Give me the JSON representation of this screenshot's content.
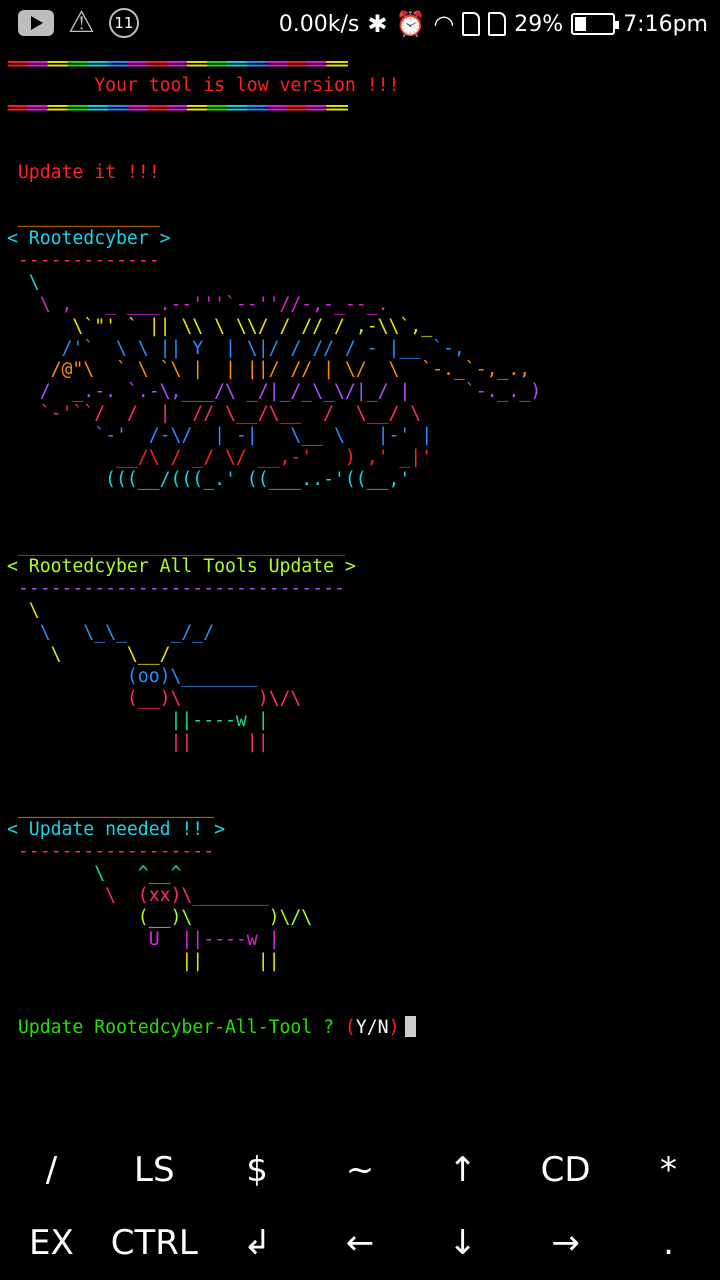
{
  "status_bar": {
    "notification_count": "11",
    "net_speed": "0.00k/s",
    "battery_percent": "29%",
    "battery_level": 0.29,
    "time": "7:16pm"
  },
  "terminal": {
    "lines": [
      {
        "text": "===================================================",
        "color": "rainbow"
      },
      {
        "text": "        Your tool is low version !!!",
        "color": "#ff2020"
      },
      {
        "text": "===================================================",
        "color": "rainbow"
      },
      {
        "text": "",
        "color": "#ffffff"
      },
      {
        "text": "",
        "color": "#ffffff"
      },
      {
        "text": " Update it !!!",
        "color": "#ff2020"
      },
      {
        "text": "",
        "color": "#ffffff"
      },
      {
        "text": " _____________",
        "color": "#ff8c00"
      },
      {
        "text": "< Rootedcyber >",
        "color": "#19d3e6"
      },
      {
        "text": " -------------",
        "color": "#ff2a6a"
      },
      {
        "text": "  \\",
        "color": "#19d3e6"
      },
      {
        "text": "   \\ ,   _ ___.--'''`--''//-,-_--_.",
        "color": "#e020e0"
      },
      {
        "text": "      \\`\"' ` || \\\\ \\ \\\\/ / // / ,-\\\\`,_",
        "color": "#e8e800"
      },
      {
        "text": "     /'`  \\ \\ || Y  | \\|/ / // / - |__ `-,",
        "color": "#2a8cff"
      },
      {
        "text": "    /@\"\\  ` \\ `\\ |  | ||/ // | \\/  \\  `-._`-,_.,",
        "color": "#ff8c00"
      },
      {
        "text": "   /  _.-. `.-\\,___/\\ _/|_/_\\_\\/|_/ |     `-._._)",
        "color": "#b050ff"
      },
      {
        "text": "   `-'``/  /  |  // \\__/\\__  /  \\__/ \\",
        "color": "#ff2a6a"
      },
      {
        "text": "        `-'  /-\\/  | -|   \\__ \\   |-' |",
        "color": "#2a8cff"
      },
      {
        "text": "          __/\\ / _/ \\/ __,-'   ) ,' _|'",
        "color": "#ff2020"
      },
      {
        "text": "         (((__/(((_.' ((___..-'((__,'",
        "color": "#19d3e6"
      },
      {
        "text": "",
        "color": "#ffffff"
      },
      {
        "text": "",
        "color": "#ffffff"
      },
      {
        "text": " ______________________________",
        "color": "#ff2a6a"
      },
      {
        "text": "< Rootedcyber All Tools Update >",
        "color": "#a8ff20"
      },
      {
        "text": " ------------------------------",
        "color": "#b050ff"
      },
      {
        "text": "  \\",
        "color": "#e8e800"
      },
      {
        "text": "   \\   \\_\\_    _/_/",
        "color": "#2a8cff"
      },
      {
        "text": "    \\      \\__/",
        "color": "#e8e800"
      },
      {
        "text": "           (oo)\\_______",
        "color": "#2a8cff"
      },
      {
        "text": "           (__)\\       )\\/\\",
        "color": "#ff2a6a"
      },
      {
        "text": "               ||----w |",
        "color": "#10e090"
      },
      {
        "text": "               ||     ||",
        "color": "#ff2a6a"
      },
      {
        "text": "",
        "color": "#ffffff"
      },
      {
        "text": "",
        "color": "#ffffff"
      },
      {
        "text": " __________________",
        "color": "#ff8c00"
      },
      {
        "text": "< Update needed !! >",
        "color": "#19d3e6"
      },
      {
        "text": " ------------------",
        "color": "#ff2a6a"
      },
      {
        "text": "        \\   ^__^",
        "color": "#10e090"
      },
      {
        "text": "         \\  (xx)\\_______",
        "color": "#ff2a6a"
      },
      {
        "text": "            (__)\\       )\\/\\",
        "color": "#a8ff20"
      },
      {
        "text": "             U  ||----w |",
        "color": "#e020e0"
      },
      {
        "text": "                ||     ||",
        "color": "#e8e800"
      },
      {
        "text": "",
        "color": "#ffffff"
      },
      {
        "text": "",
        "color": "#ffffff"
      }
    ],
    "prompt": {
      "text": " Update Rootedcyber-All-Tool ? ",
      "open_paren": "(",
      "choice": "Y/N",
      "close_paren": ")"
    }
  },
  "extra_keys": {
    "row1": [
      "/",
      "LS",
      "$",
      "~",
      "↑",
      "CD",
      "*"
    ],
    "row2": [
      "EX",
      "CTRL",
      "↲",
      "←",
      "↓",
      "→",
      "."
    ]
  }
}
